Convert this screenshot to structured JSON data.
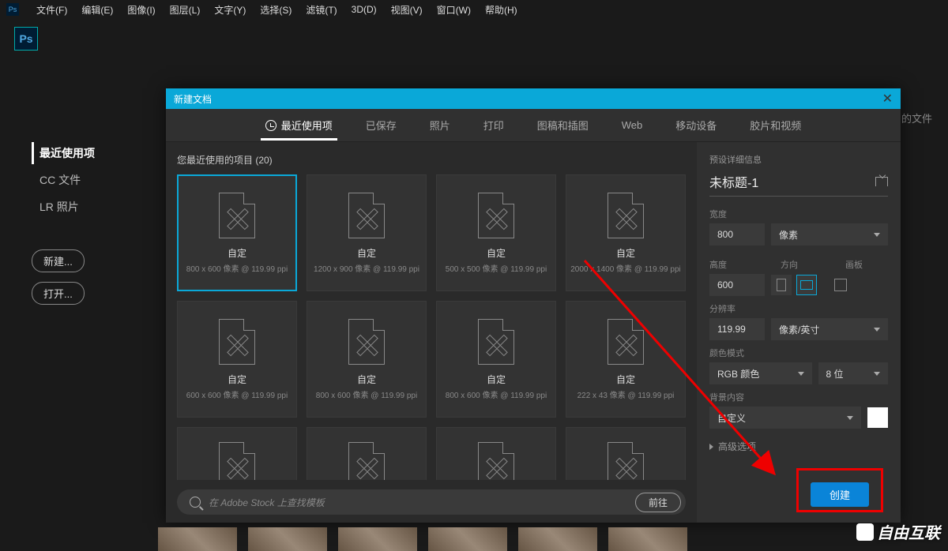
{
  "menubar": {
    "items": [
      "文件(F)",
      "编辑(E)",
      "图像(I)",
      "图层(L)",
      "文字(Y)",
      "选择(S)",
      "滤镜(T)",
      "3D(D)",
      "视图(V)",
      "窗口(W)",
      "帮助(H)"
    ]
  },
  "app_badge": "Ps",
  "start_sidebar": {
    "items": [
      {
        "label": "最近使用项",
        "active": true
      },
      {
        "label": "CC 文件",
        "active": false
      },
      {
        "label": "LR 照片",
        "active": false
      }
    ],
    "new_btn": "新建...",
    "open_btn": "打开..."
  },
  "bg_hint": "的文件",
  "dialog": {
    "title": "新建文档",
    "close": "✕",
    "tabs": [
      "最近使用项",
      "已保存",
      "照片",
      "打印",
      "图稿和插图",
      "Web",
      "移动设备",
      "胶片和视频"
    ],
    "active_tab": 0,
    "recent_header": "您最近使用的项目  (20)",
    "presets": [
      {
        "name": "自定",
        "sub": "800 x 600 像素 @ 119.99 ppi",
        "selected": true
      },
      {
        "name": "自定",
        "sub": "1200 x 900 像素 @ 119.99 ppi"
      },
      {
        "name": "自定",
        "sub": "500 x 500 像素 @ 119.99 ppi"
      },
      {
        "name": "自定",
        "sub": "2000 x 1400 像素 @ 119.99 ppi"
      },
      {
        "name": "自定",
        "sub": "600 x 600 像素 @ 119.99 ppi"
      },
      {
        "name": "自定",
        "sub": "800 x 600 像素 @ 119.99 ppi"
      },
      {
        "name": "自定",
        "sub": "800 x 600 像素 @ 119.99 ppi"
      },
      {
        "name": "自定",
        "sub": "222 x 43 像素 @ 119.99 ppi"
      },
      {
        "short": true
      },
      {
        "short": true
      },
      {
        "short": true
      },
      {
        "short": true
      }
    ],
    "search_placeholder": "在 Adobe Stock 上查找模板",
    "go_label": "前往",
    "detail": {
      "section": "预设详细信息",
      "doc_name": "未标题-1",
      "width_lbl": "宽度",
      "width_val": "800",
      "width_unit": "像素",
      "height_lbl": "高度",
      "height_val": "600",
      "orient_lbl": "方向",
      "artboard_lbl": "画板",
      "res_lbl": "分辨率",
      "res_val": "119.99",
      "res_unit": "像素/英寸",
      "color_lbl": "颜色模式",
      "color_mode": "RGB 颜色",
      "color_depth": "8 位",
      "bg_lbl": "背景内容",
      "bg_val": "自定义",
      "adv_lbl": "高级选项",
      "create_btn": "创建"
    }
  },
  "watermark": "自由互联"
}
